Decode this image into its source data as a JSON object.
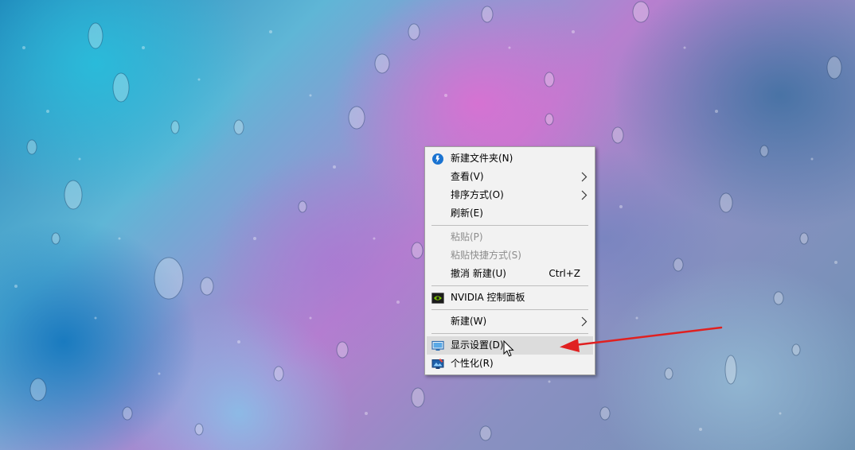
{
  "context_menu": {
    "items": [
      {
        "label": "新建文件夹(N)",
        "icon": "new-folder-icon"
      },
      {
        "label": "查看(V)",
        "submenu": true
      },
      {
        "label": "排序方式(O)",
        "submenu": true
      },
      {
        "label": "刷新(E)"
      },
      {
        "label": "粘贴(P)",
        "disabled": true
      },
      {
        "label": "粘贴快捷方式(S)",
        "disabled": true
      },
      {
        "label": "撤消 新建(U)",
        "shortcut": "Ctrl+Z"
      },
      {
        "label": "NVIDIA 控制面板",
        "icon": "nvidia-icon"
      },
      {
        "label": "新建(W)",
        "submenu": true
      },
      {
        "label": "显示设置(D)",
        "icon": "display-icon",
        "highlighted": true
      },
      {
        "label": "个性化(R)",
        "icon": "personalize-icon"
      }
    ]
  },
  "annotation": {
    "color": "#e02020",
    "points_to": "显示设置(D)"
  },
  "colors": {
    "menu_background": "#f2f2f2",
    "menu_hover": "#dcdcdc",
    "disabled_text": "#8d8d8d"
  }
}
